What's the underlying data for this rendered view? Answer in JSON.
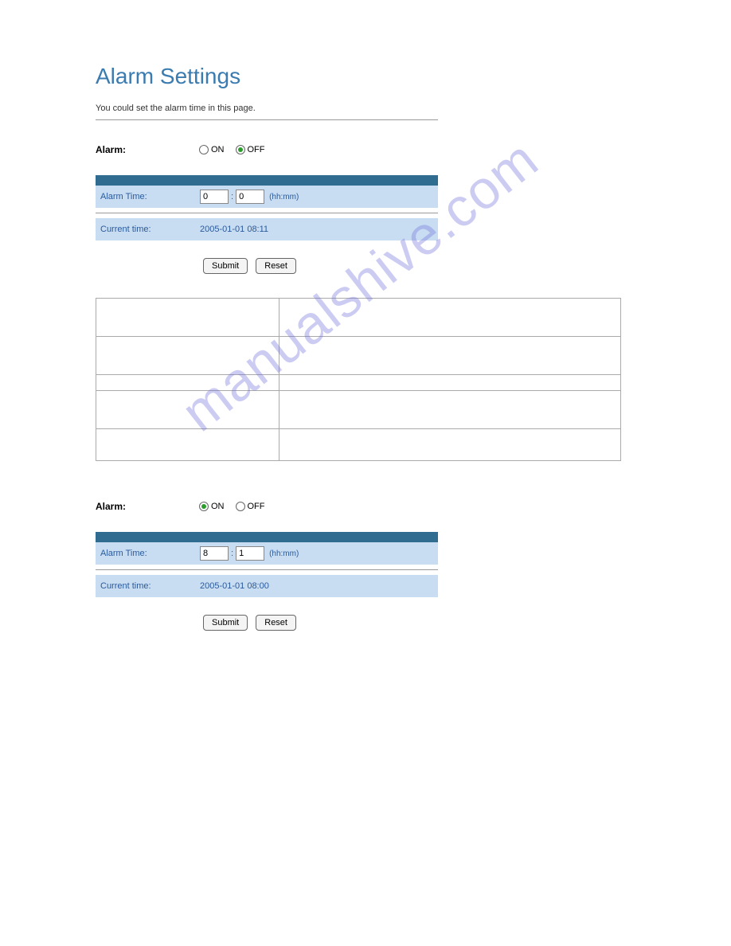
{
  "title": "Alarm Settings",
  "subtitle": "You could set the alarm time in this page.",
  "watermark": "manualshive.com",
  "form1": {
    "alarm_label": "Alarm:",
    "on_label": "ON",
    "off_label": "OFF",
    "selected": "OFF",
    "alarm_time_label": "Alarm Time:",
    "hh_value": "0",
    "mm_value": "0",
    "hint": "(hh:mm)",
    "current_time_label": "Current time:",
    "current_time_value": "2005-01-01 08:11",
    "submit": "Submit",
    "reset": "Reset"
  },
  "form2": {
    "alarm_label": "Alarm:",
    "on_label": "ON",
    "off_label": "OFF",
    "selected": "ON",
    "alarm_time_label": "Alarm Time:",
    "hh_value": "8",
    "mm_value": "1",
    "hint": "(hh:mm)",
    "current_time_label": "Current time:",
    "current_time_value": "2005-01-01 08:00",
    "submit": "Submit",
    "reset": "Reset"
  },
  "desc_table": {
    "rows": [
      {
        "c1": "",
        "c2": ""
      },
      {
        "c1": "",
        "c2": ""
      },
      {
        "c1": "",
        "c2": ""
      },
      {
        "c1": "",
        "c2": ""
      },
      {
        "c1": "",
        "c2": ""
      }
    ]
  }
}
